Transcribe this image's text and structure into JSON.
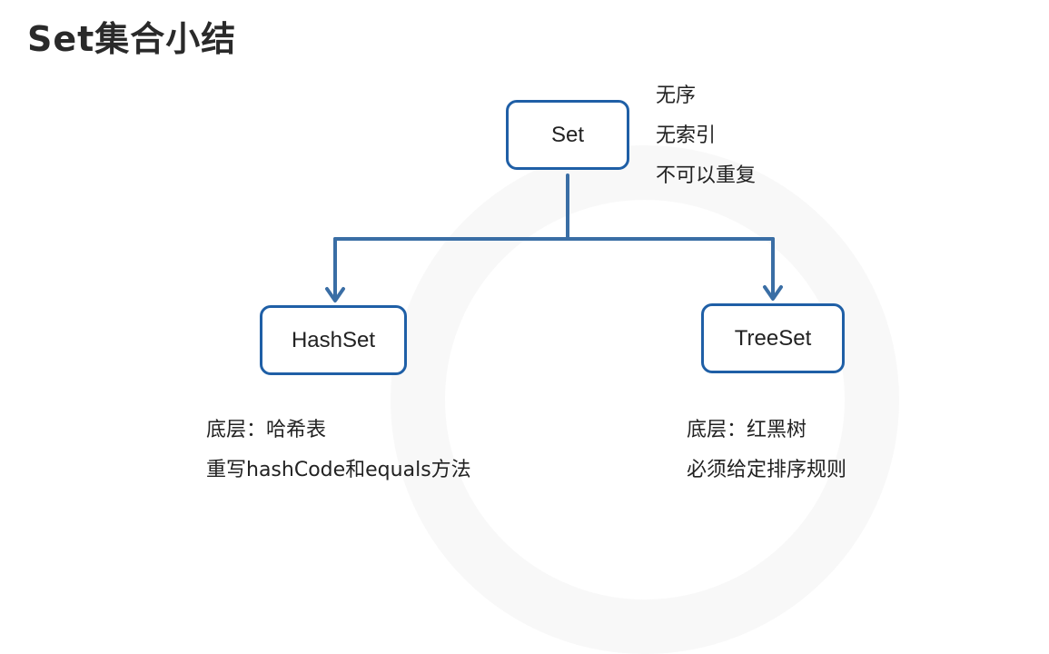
{
  "title": "Set集合小结",
  "root": {
    "label": "Set",
    "notes": [
      "无序",
      "无索引",
      "不可以重复"
    ]
  },
  "children": [
    {
      "label": "HashSet",
      "notes": [
        "底层：哈希表",
        "重写hashCode和equals方法"
      ]
    },
    {
      "label": "TreeSet",
      "notes": [
        "底层：红黑树",
        "必须给定排序规则"
      ]
    }
  ],
  "colors": {
    "node_border": "#1f5fa6",
    "connector": "#3a6ea5"
  }
}
